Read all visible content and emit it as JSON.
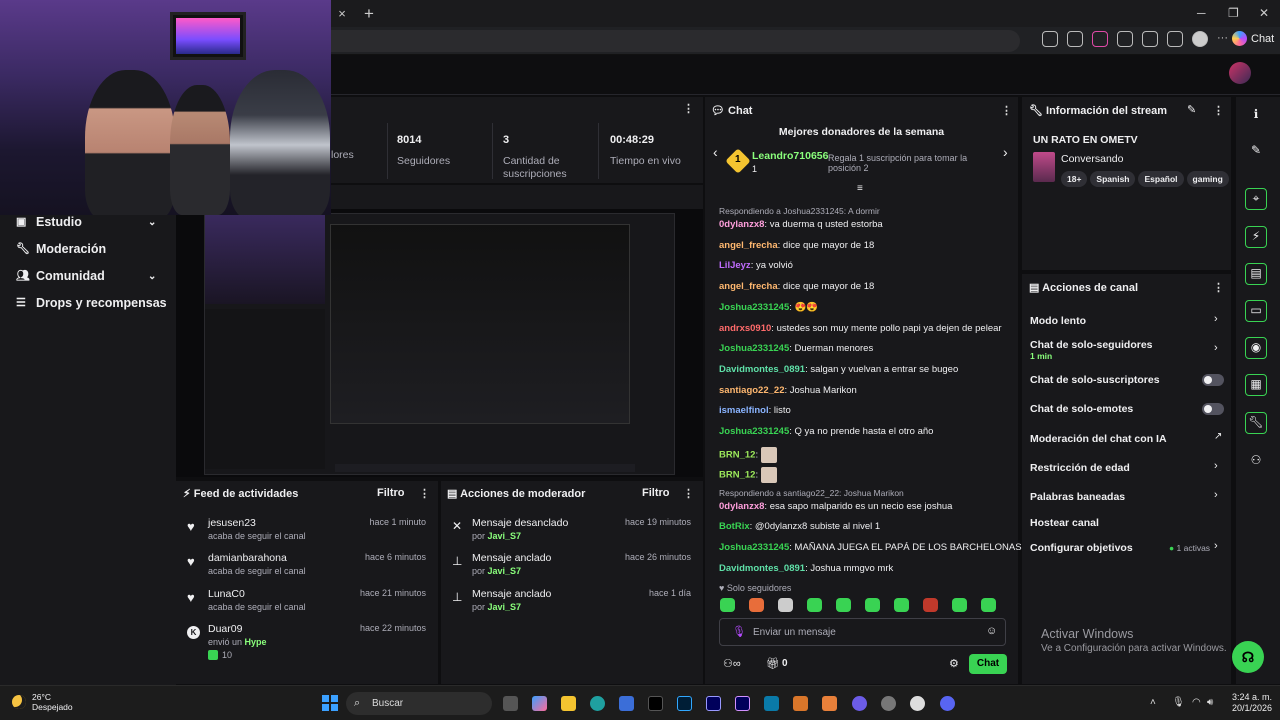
{
  "browser": {
    "tab_close": "×",
    "new_tab": "+",
    "copilot_label": "Chat"
  },
  "stats": [
    {
      "value": "",
      "label": "lores"
    },
    {
      "value": "8014",
      "label": "Seguidores"
    },
    {
      "value": "3",
      "label": "Cantidad de suscripciones"
    },
    {
      "value": "00:48:29",
      "label": "Tiempo en vivo"
    }
  ],
  "left_nav": [
    {
      "label": "Estudio",
      "icon": "studio-icon",
      "chevron": true
    },
    {
      "label": "Moderación",
      "icon": "wrench-icon",
      "chevron": false
    },
    {
      "label": "Comunidad",
      "icon": "community-icon",
      "chevron": true
    },
    {
      "label": "Drops y recompensas",
      "icon": "gift-icon",
      "chevron": false
    }
  ],
  "activity_feed": {
    "title": "Feed de actividades",
    "filter": "Filtro",
    "items": [
      {
        "name": "jesusen23",
        "desc": "acaba de seguir el canal",
        "time": "hace 1 minuto"
      },
      {
        "name": "damianbarahona",
        "desc": "acaba de seguir el canal",
        "time": "hace 6 minutos"
      },
      {
        "name": "LunaC0",
        "desc": "acaba de seguir el canal",
        "time": "hace 21 minutos"
      },
      {
        "name": "Duar09",
        "desc": "envió un",
        "highlight": "Hype",
        "amount": "10",
        "time": "hace 22 minutos"
      }
    ]
  },
  "mod_actions": {
    "title": "Acciones de moderador",
    "filter": "Filtro",
    "items": [
      {
        "action": "Mensaje desanclado",
        "by": "por",
        "user": "Javi_S7",
        "time": "hace 19 minutos"
      },
      {
        "action": "Mensaje anclado",
        "by": "por",
        "user": "Javi_S7",
        "time": "hace 26 minutos"
      },
      {
        "action": "Mensaje anclado",
        "by": "por",
        "user": "Javi_S7",
        "time": "hace 1 día"
      }
    ]
  },
  "chat": {
    "title": "Chat",
    "donors_title": "Mejores donadores de la semana",
    "top_donor": "Leandro710656",
    "donor_rank": "1",
    "donor_count": "1",
    "gift_hint": "Regala 1 suscripción para tomar la posición 2",
    "messages": [
      {
        "reply": "Respondiendo a Joshua2331245: A dormir"
      },
      {
        "user": "0dylanzx8",
        "color": "#ff9fdc",
        "text": "va duerma q usted estorba"
      },
      {
        "user": "angel_frecha",
        "color": "#ffb870",
        "text": "dice que mayor de 18"
      },
      {
        "user": "LilJeyz",
        "color": "#c06cff",
        "text": "ya volvió"
      },
      {
        "user": "angel_frecha",
        "color": "#ffb870",
        "text": "dice que mayor de 18"
      },
      {
        "user": "Joshua2331245",
        "color": "#39d353",
        "text": "😍😍"
      },
      {
        "user": "andrxs0910",
        "color": "#ff6b6b",
        "text": "ustedes son muy mente pollo papi ya dejen de pelear"
      },
      {
        "user": "Joshua2331245",
        "color": "#39d353",
        "text": "Duerman menores"
      },
      {
        "user": "Davidmontes_0891",
        "color": "#5fe0a8",
        "text": "salgan y vuelvan a entrar se bugeo"
      },
      {
        "user": "santiago22_22",
        "color": "#ffb870",
        "text": "Joshua Marikon"
      },
      {
        "user": "ismaelfinol",
        "color": "#8ab4ff",
        "text": "listo"
      },
      {
        "user": "Joshua2331245",
        "color": "#39d353",
        "text": "Q ya no prende hasta el otro año"
      },
      {
        "user": "BRN_12",
        "color": "#9be85a",
        "text": ""
      },
      {
        "user": "BRN_12",
        "color": "#9be85a",
        "text": ""
      },
      {
        "reply": "Respondiendo a santiago22_22: Joshua Marikon"
      },
      {
        "user": "0dylanzx8",
        "color": "#ff9fdc",
        "text": "esa sapo malparido es un necio ese joshua"
      },
      {
        "user": "BotRix",
        "color": "#39d353",
        "text": "@0dylanzx8 subiste al nivel 1"
      },
      {
        "user": "Joshua2331245",
        "color": "#39d353",
        "text": "MAÑANA JUEGA EL PAPÁ DE LOS BARCHELONAS"
      },
      {
        "user": "Davidmontes_0891",
        "color": "#5fe0a8",
        "text": "Joshua mmgvo mrk"
      }
    ],
    "followers_only": "Solo seguidores",
    "input_placeholder": "Enviar un mensaje",
    "points": "0",
    "send_label": "Chat"
  },
  "stream_info": {
    "title": "Información del stream",
    "stream_title": "UN RATO EN OMETV",
    "category": "Conversando",
    "tags": [
      "18+",
      "Spanish",
      "Español",
      "gaming"
    ]
  },
  "channel_actions": {
    "title": "Acciones de canal",
    "items": [
      {
        "label": "Modo lento",
        "type": "chevron"
      },
      {
        "label": "Chat de solo-seguidores",
        "sub": "1 min",
        "type": "chevron"
      },
      {
        "label": "Chat de solo-suscriptores",
        "type": "toggle"
      },
      {
        "label": "Chat de solo-emotes",
        "type": "toggle"
      },
      {
        "label": "Moderación del chat con IA",
        "type": "external"
      },
      {
        "label": "Restricción de edad",
        "type": "chevron"
      },
      {
        "label": "Palabras baneadas",
        "type": "chevron"
      },
      {
        "label": "Hostear canal",
        "type": "none"
      },
      {
        "label": "Configurar objetivos",
        "status": "1 activas",
        "type": "chevron"
      }
    ]
  },
  "windows": {
    "activate_title": "Activar Windows",
    "activate_sub": "Ve a Configuración para activar Windows."
  },
  "taskbar": {
    "temp": "26°C",
    "weather": "Despejado",
    "search": "Buscar",
    "time": "3:24 a. m.",
    "date": "20/1/2026"
  },
  "colors": {
    "accent": "#39d353",
    "bg": "#0e0e10",
    "panel": "#18181b"
  }
}
